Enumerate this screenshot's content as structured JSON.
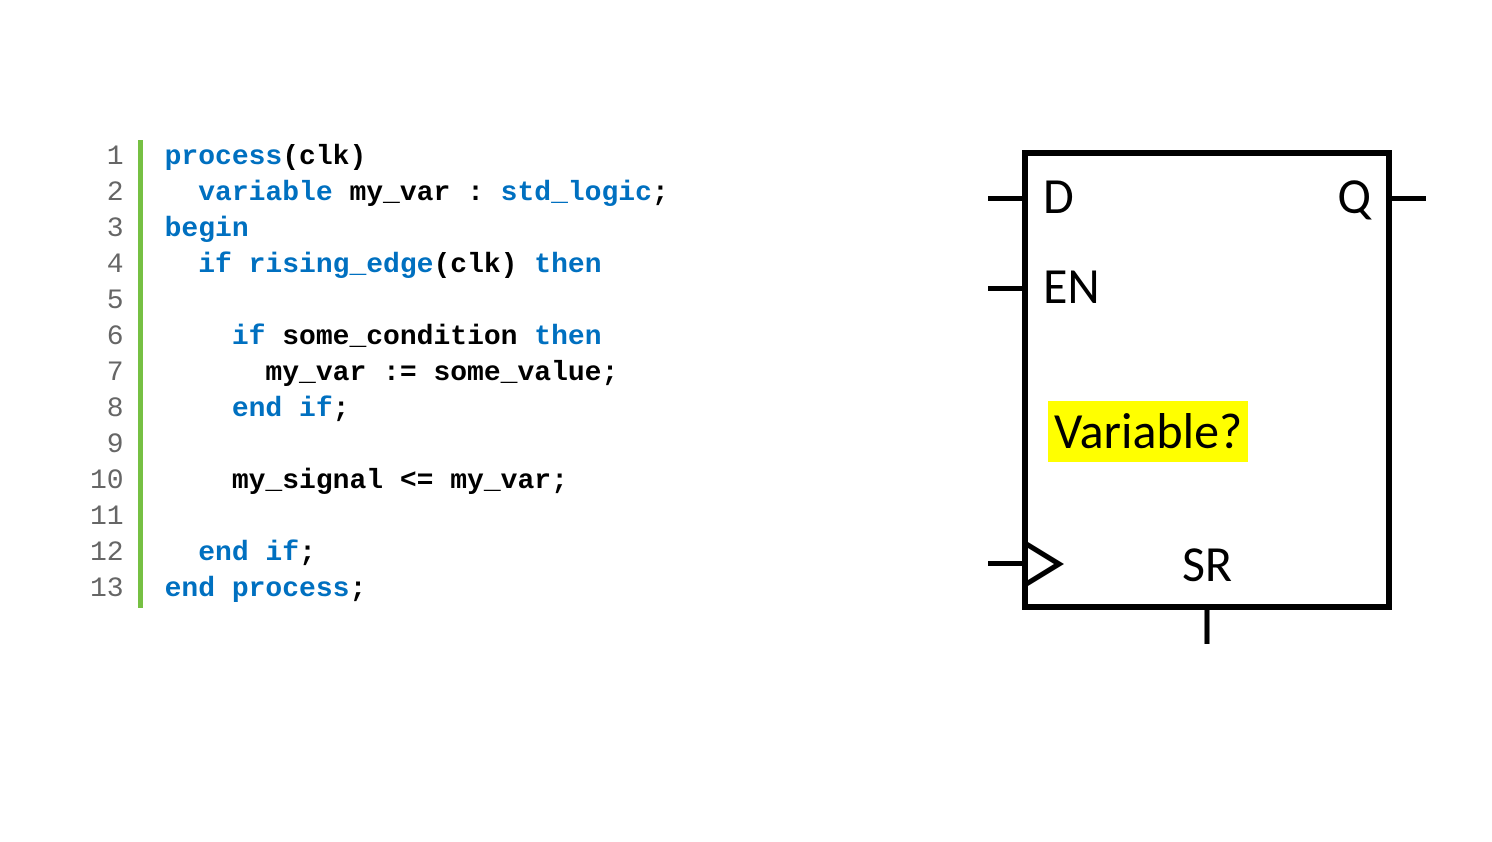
{
  "code": {
    "line_count": 13,
    "lines": [
      {
        "n": 1,
        "tokens": [
          {
            "t": "process",
            "c": "kw"
          },
          {
            "t": "(clk)"
          }
        ]
      },
      {
        "n": 2,
        "tokens": [
          {
            "t": "  "
          },
          {
            "t": "variable",
            "c": "kw"
          },
          {
            "t": " my_var : "
          },
          {
            "t": "std_logic",
            "c": "type"
          },
          {
            "t": ";"
          }
        ]
      },
      {
        "n": 3,
        "tokens": [
          {
            "t": "begin",
            "c": "kw"
          }
        ]
      },
      {
        "n": 4,
        "tokens": [
          {
            "t": "  "
          },
          {
            "t": "if rising_edge",
            "c": "kw"
          },
          {
            "t": "(clk) "
          },
          {
            "t": "then",
            "c": "kw"
          }
        ]
      },
      {
        "n": 5,
        "tokens": []
      },
      {
        "n": 6,
        "tokens": [
          {
            "t": "    "
          },
          {
            "t": "if",
            "c": "kw"
          },
          {
            "t": " some_condition "
          },
          {
            "t": "then",
            "c": "kw"
          }
        ]
      },
      {
        "n": 7,
        "tokens": [
          {
            "t": "      my_var := some_value;"
          }
        ]
      },
      {
        "n": 8,
        "tokens": [
          {
            "t": "    "
          },
          {
            "t": "end if",
            "c": "kw"
          },
          {
            "t": ";"
          }
        ]
      },
      {
        "n": 9,
        "tokens": []
      },
      {
        "n": 10,
        "tokens": [
          {
            "t": "    my_signal <= my_var;"
          }
        ]
      },
      {
        "n": 11,
        "tokens": []
      },
      {
        "n": 12,
        "tokens": [
          {
            "t": "  "
          },
          {
            "t": "end if",
            "c": "kw"
          },
          {
            "t": ";"
          }
        ]
      },
      {
        "n": 13,
        "tokens": [
          {
            "t": "end process",
            "c": "kw"
          },
          {
            "t": ";"
          }
        ]
      }
    ]
  },
  "diagram": {
    "pin_d": "D",
    "pin_q": "Q",
    "pin_en": "EN",
    "pin_sr": "SR",
    "highlight": "Variable?"
  }
}
